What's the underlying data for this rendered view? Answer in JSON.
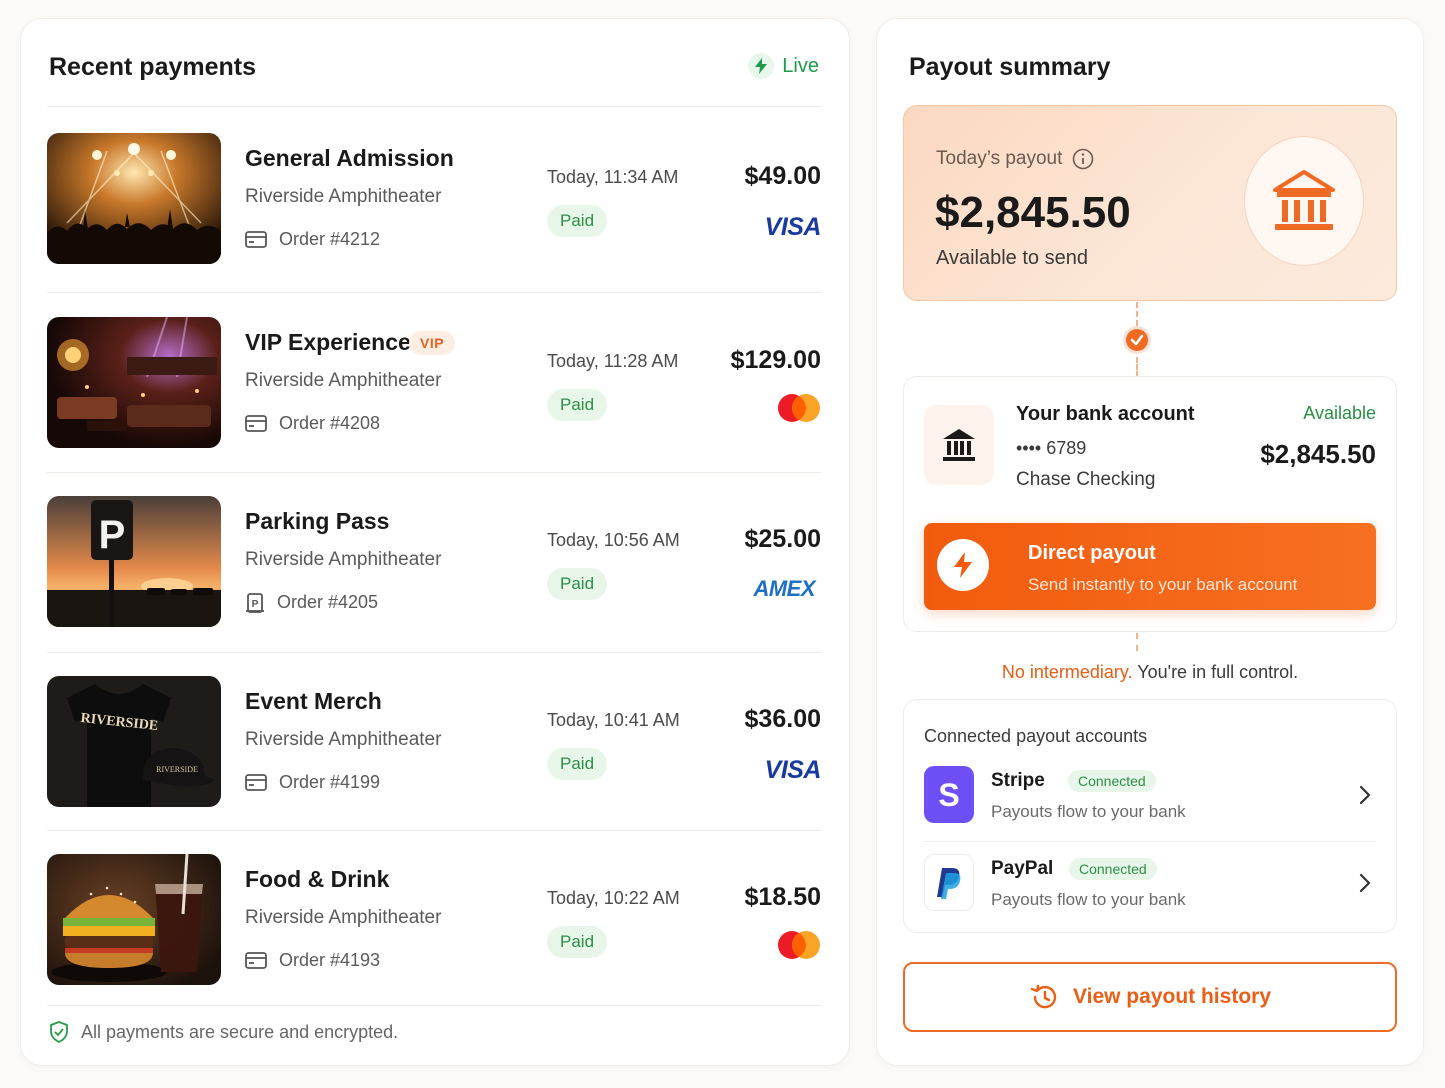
{
  "recent_payments": {
    "title": "Recent payments",
    "live_label": "Live",
    "items": [
      {
        "name": "General Admission",
        "venue": "Riverside Amphitheater",
        "order": "Order #4212",
        "time": "Today, 11:34 AM",
        "status": "Paid",
        "amount": "$49.00",
        "card_brand": "VISA",
        "image": "concert-crowd-image"
      },
      {
        "name": "VIP Experience",
        "badge": "VIP",
        "venue": "Riverside Amphitheater",
        "order": "Order #4208",
        "time": "Today, 11:28 AM",
        "status": "Paid",
        "amount": "$129.00",
        "card_brand": "mastercard",
        "image": "vip-lounge-image"
      },
      {
        "name": "Parking Pass",
        "venue": "Riverside Amphitheater",
        "order": "Order #4205",
        "time": "Today, 10:56 AM",
        "status": "Paid",
        "amount": "$25.00",
        "card_brand": "AMEX",
        "image": "parking-sign-image"
      },
      {
        "name": "Event Merch",
        "venue": "Riverside Amphitheater",
        "order": "Order #4199",
        "time": "Today, 10:41 AM",
        "status": "Paid",
        "amount": "$36.00",
        "card_brand": "VISA",
        "image": "merch-tshirt-image"
      },
      {
        "name": "Food & Drink",
        "venue": "Riverside Amphitheater",
        "order": "Order #4193",
        "time": "Today, 10:22 AM",
        "status": "Paid",
        "amount": "$18.50",
        "card_brand": "mastercard",
        "image": "burger-drink-image"
      }
    ],
    "secure_note": "All payments are secure and encrypted."
  },
  "payout_summary": {
    "title": "Payout summary",
    "todays_label": "Today’s payout",
    "amount": "$2,845.50",
    "available_text": "Available to send",
    "bank": {
      "name": "Your bank account",
      "mask": "•••• 6789",
      "type": "Chase Checking",
      "available_label": "Available",
      "available_amount": "$2,845.50"
    },
    "direct_payout": {
      "title": "Direct payout",
      "subtitle": "Send instantly to your bank account"
    },
    "control_highlight": "No intermediary.",
    "control_rest": " You're in full control.",
    "connected": {
      "title": "Connected payout accounts",
      "accounts": [
        {
          "name": "Stripe",
          "badge": "Connected",
          "subtitle": "Payouts flow to your bank"
        },
        {
          "name": "PayPal",
          "badge": "Connected",
          "subtitle": "Payouts flow to your bank"
        }
      ]
    },
    "history_button": "View payout history"
  },
  "colors": {
    "accent": "#f25b0e",
    "paid_green": "#2a8f45",
    "visa_blue": "#1a3b9e",
    "amex_blue": "#1f6fc5",
    "stripe_purple": "#6e4ff5"
  }
}
